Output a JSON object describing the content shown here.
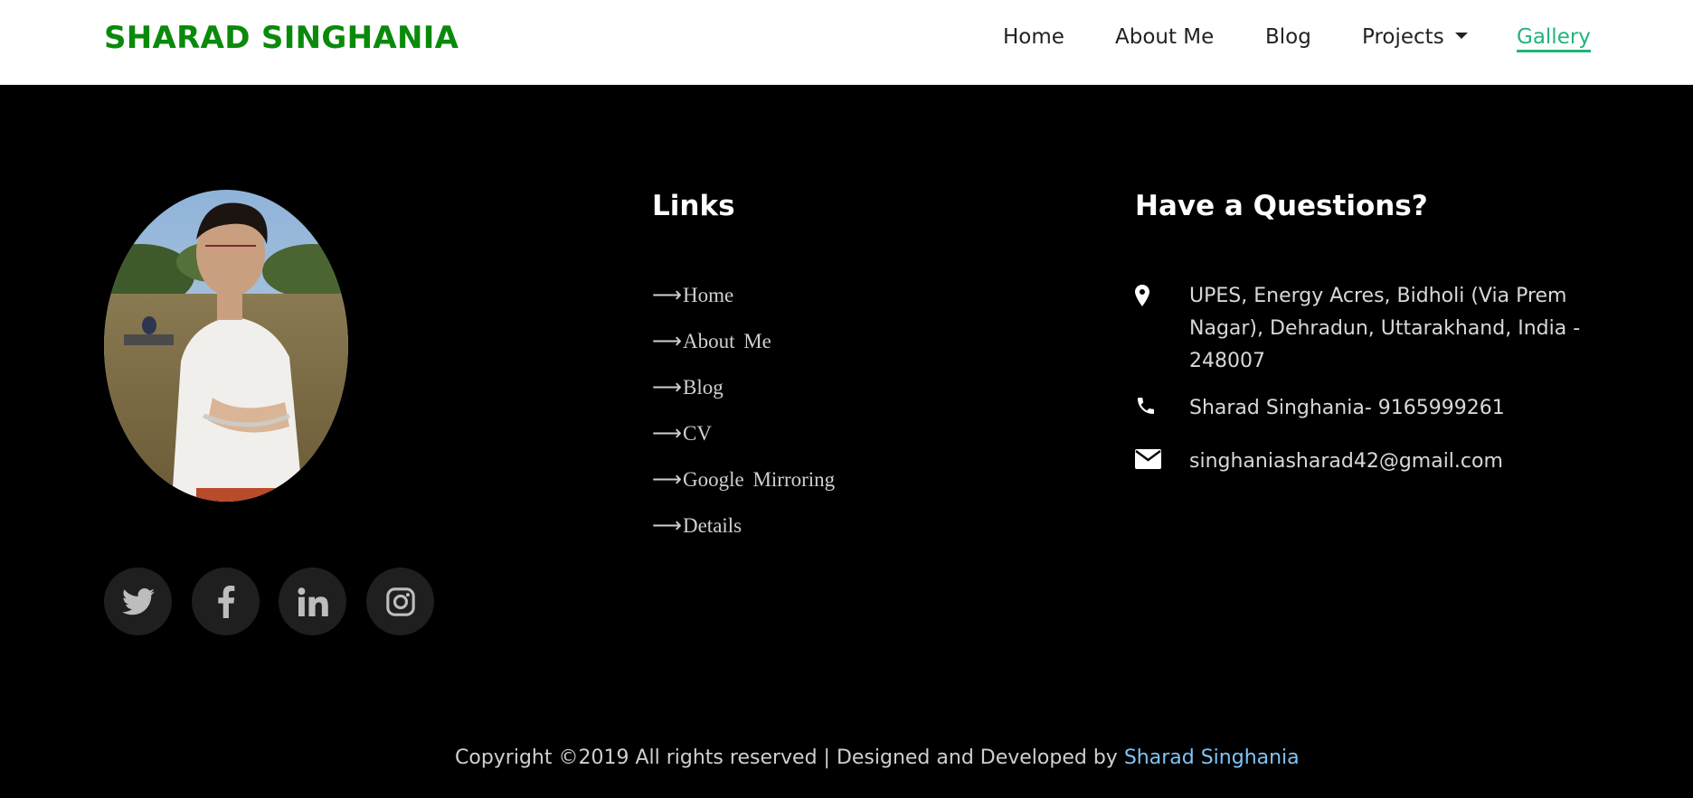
{
  "navbar": {
    "brand": "SHARAD SINGHANIA",
    "links": {
      "home": "Home",
      "about": "About Me",
      "blog": "Blog",
      "projects": "Projects",
      "gallery": "Gallery"
    },
    "active": "Gallery",
    "colors": {
      "brand": "#0a8a0a",
      "active": "#21b47a"
    }
  },
  "footer": {
    "profile_image": "profile-photo",
    "social": [
      "twitter-icon",
      "facebook-icon",
      "linkedin-icon",
      "instagram-icon"
    ],
    "links_section": {
      "title": "Links",
      "arrow": "⟶",
      "items": [
        "Home",
        "About  Me",
        "Blog",
        "CV",
        "Google  Mirroring",
        "Details"
      ]
    },
    "contact_section": {
      "title": "Have a Questions?",
      "address": "UPES, Energy Acres, Bidholi (Via Prem Nagar), Dehradun, Uttarakhand, India - 248007",
      "phone": "Sharad Singhania- 9165999261",
      "email": "singhaniasharad42@gmail.com"
    },
    "copyright": {
      "text": "Copyright ©2019 All rights reserved | Designed and Developed by ",
      "author": "Sharad Singhania",
      "author_color": "#7fc4f5"
    }
  }
}
